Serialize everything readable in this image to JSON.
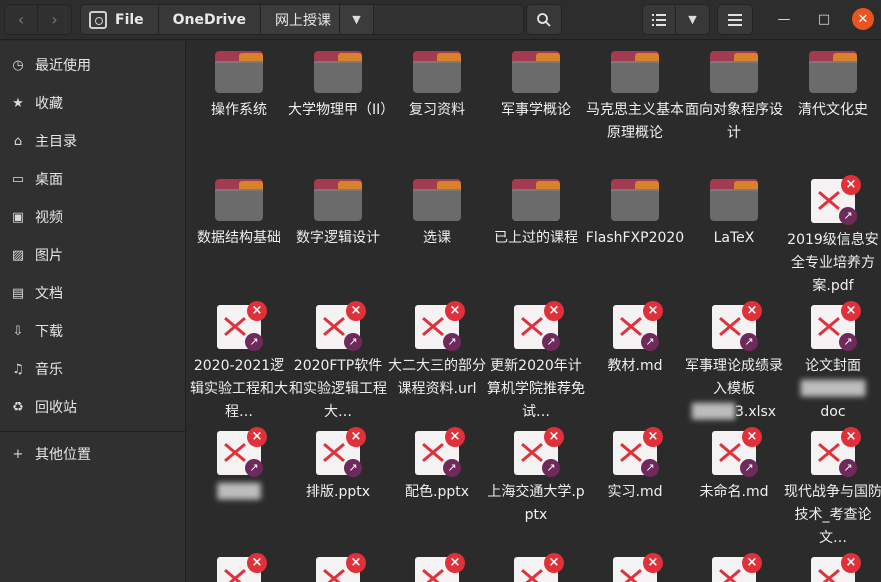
{
  "header": {
    "nav_back": "‹",
    "nav_forward": "›",
    "breadcrumb": [
      "File",
      "OneDrive",
      "网上授课"
    ],
    "search_icon": "search-icon",
    "view_list_icon": "list-view-icon",
    "menu_icon": "hamburger-icon"
  },
  "sidebar": {
    "items": [
      {
        "label": "最近使用",
        "icon": "clock-icon"
      },
      {
        "label": "收藏",
        "icon": "star-icon"
      },
      {
        "label": "主目录",
        "icon": "home-icon"
      },
      {
        "label": "桌面",
        "icon": "desktop-icon"
      },
      {
        "label": "视频",
        "icon": "video-icon"
      },
      {
        "label": "图片",
        "icon": "image-icon"
      },
      {
        "label": "文档",
        "icon": "document-icon"
      },
      {
        "label": "下载",
        "icon": "download-icon"
      },
      {
        "label": "音乐",
        "icon": "music-icon"
      },
      {
        "label": "回收站",
        "icon": "trash-icon"
      },
      {
        "label": "其他位置",
        "icon": "plus-icon"
      }
    ]
  },
  "files": [
    {
      "name": "操作系统",
      "type": "folder"
    },
    {
      "name": "大学物理甲（II）",
      "type": "folder"
    },
    {
      "name": "复习资料",
      "type": "folder"
    },
    {
      "name": "军事学概论",
      "type": "folder"
    },
    {
      "name": "马克思主义基本原理概论",
      "type": "folder"
    },
    {
      "name": "面向对象程序设计",
      "type": "folder"
    },
    {
      "name": "清代文化史",
      "type": "folder"
    },
    {
      "name": "数据结构基础",
      "type": "folder"
    },
    {
      "name": "数字逻辑设计",
      "type": "folder"
    },
    {
      "name": "选课",
      "type": "folder"
    },
    {
      "name": "已上过的课程",
      "type": "folder"
    },
    {
      "name": "FlashFXP2020",
      "type": "folder"
    },
    {
      "name": "LaTeX",
      "type": "folder"
    },
    {
      "name": "2019级信息安全专业培养方案.pdf",
      "type": "file"
    },
    {
      "name": "2020-2021逻辑实验工程和大程…",
      "type": "file"
    },
    {
      "name": "2020FTP软件和实验逻辑工程大…",
      "type": "file"
    },
    {
      "name": "大二大三的部分课程资料.url",
      "type": "file"
    },
    {
      "name": "更新2020年计算机学院推荐免试…",
      "type": "file"
    },
    {
      "name": "教材.md",
      "type": "file"
    },
    {
      "name": "军事理论成绩录入模板",
      "name_tail": "3.xlsx",
      "type": "file"
    },
    {
      "name": "论文封面",
      "name_tail": "doc",
      "type": "file"
    },
    {
      "name": "",
      "type": "file"
    },
    {
      "name": "排版.pptx",
      "type": "file"
    },
    {
      "name": "配色.pptx",
      "type": "file"
    },
    {
      "name": "上海交通大学.pptx",
      "type": "file"
    },
    {
      "name": "实习.md",
      "type": "file"
    },
    {
      "name": "未命名.md",
      "type": "file"
    },
    {
      "name": "现代战争与国防技术_考查论文…",
      "type": "file"
    }
  ]
}
